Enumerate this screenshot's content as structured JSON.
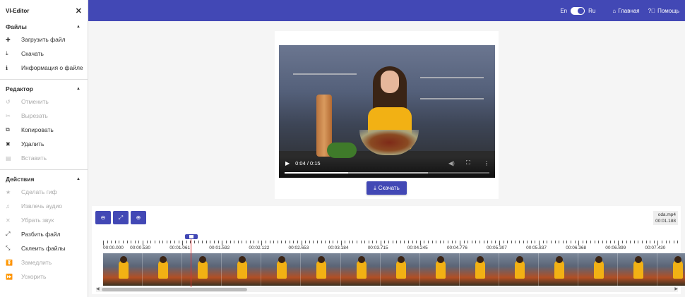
{
  "sidebar": {
    "title": "VI-Editor",
    "sections": [
      {
        "title": "Файлы",
        "items": [
          {
            "label": "Загрузить файл",
            "icon": "plus-icon",
            "disabled": false
          },
          {
            "label": "Скачать",
            "icon": "download-icon",
            "disabled": false
          },
          {
            "label": "Информация о файле",
            "icon": "info-icon",
            "disabled": false
          }
        ]
      },
      {
        "title": "Редактор",
        "items": [
          {
            "label": "Отменить",
            "icon": "undo-icon",
            "disabled": true
          },
          {
            "label": "Вырезать",
            "icon": "scissors-icon",
            "disabled": true
          },
          {
            "label": "Копировать",
            "icon": "copy-icon",
            "disabled": false
          },
          {
            "label": "Удалить",
            "icon": "delete-icon",
            "disabled": false
          },
          {
            "label": "Вставить",
            "icon": "paste-icon",
            "disabled": true
          }
        ]
      },
      {
        "title": "Действия",
        "items": [
          {
            "label": "Сделать гиф",
            "icon": "star-icon",
            "disabled": true
          },
          {
            "label": "Извлечь аудио",
            "icon": "audio-icon",
            "disabled": true
          },
          {
            "label": "Убрать звук",
            "icon": "mute-icon",
            "disabled": true
          },
          {
            "label": "Разбить файл",
            "icon": "split-icon",
            "disabled": false
          },
          {
            "label": "Склеить файлы",
            "icon": "merge-icon",
            "disabled": false
          },
          {
            "label": "Замедлить",
            "icon": "slow-icon",
            "disabled": true
          },
          {
            "label": "Ускорить",
            "icon": "fast-icon",
            "disabled": true
          }
        ]
      }
    ]
  },
  "topbar": {
    "lang_en": "En",
    "lang_ru": "Ru",
    "home_label": "Главная",
    "help_label": "Помощь"
  },
  "player": {
    "time": "0:04 / 0:15",
    "played_fraction": 0.31,
    "buffered_fraction": 0.7,
    "download_label": "Скачать"
  },
  "timeline": {
    "file_name": "oda.mp4",
    "current_time": "00:01.188",
    "ticks": [
      "00:00.000",
      "00:00.530",
      "00:01.061",
      "00:01.592",
      "00:02.122",
      "00:02.653",
      "00:03.184",
      "00:03.715",
      "00:04.245",
      "00:04.776",
      "00:05.307",
      "00:05.837",
      "00:06.368",
      "00:06.899",
      "00:07.430"
    ],
    "frame_count": 15
  },
  "colors": {
    "accent": "#4248b5",
    "playhead": "#dd3333"
  }
}
